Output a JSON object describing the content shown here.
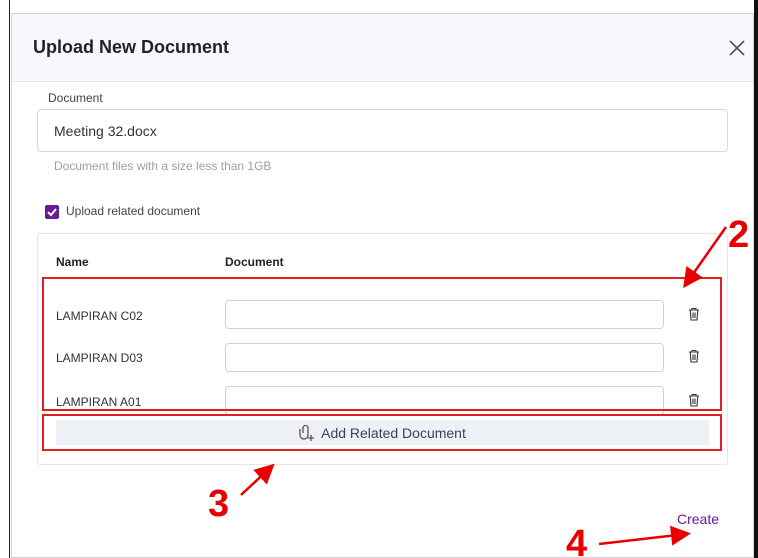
{
  "modal": {
    "title": "Upload New Document",
    "document_label": "Document",
    "document_value": "Meeting 32.docx",
    "hint": "Document files with a size less than 1GB",
    "related_checkbox_label": "Upload related document",
    "related_checked": true,
    "table": {
      "headers": [
        "Name",
        "Document"
      ],
      "rows": [
        {
          "name": "LAMPIRAN C02",
          "document": ""
        },
        {
          "name": "LAMPIRAN D03",
          "document": ""
        },
        {
          "name": "LAMPIRAN A01",
          "document": ""
        }
      ]
    },
    "add_related_label": "Add Related Document",
    "create_label": "Create"
  },
  "annotations": {
    "step2": "2",
    "step3": "3",
    "step4": "4"
  },
  "colors": {
    "accent": "#6a1b9a",
    "annotation": "#e80000"
  }
}
